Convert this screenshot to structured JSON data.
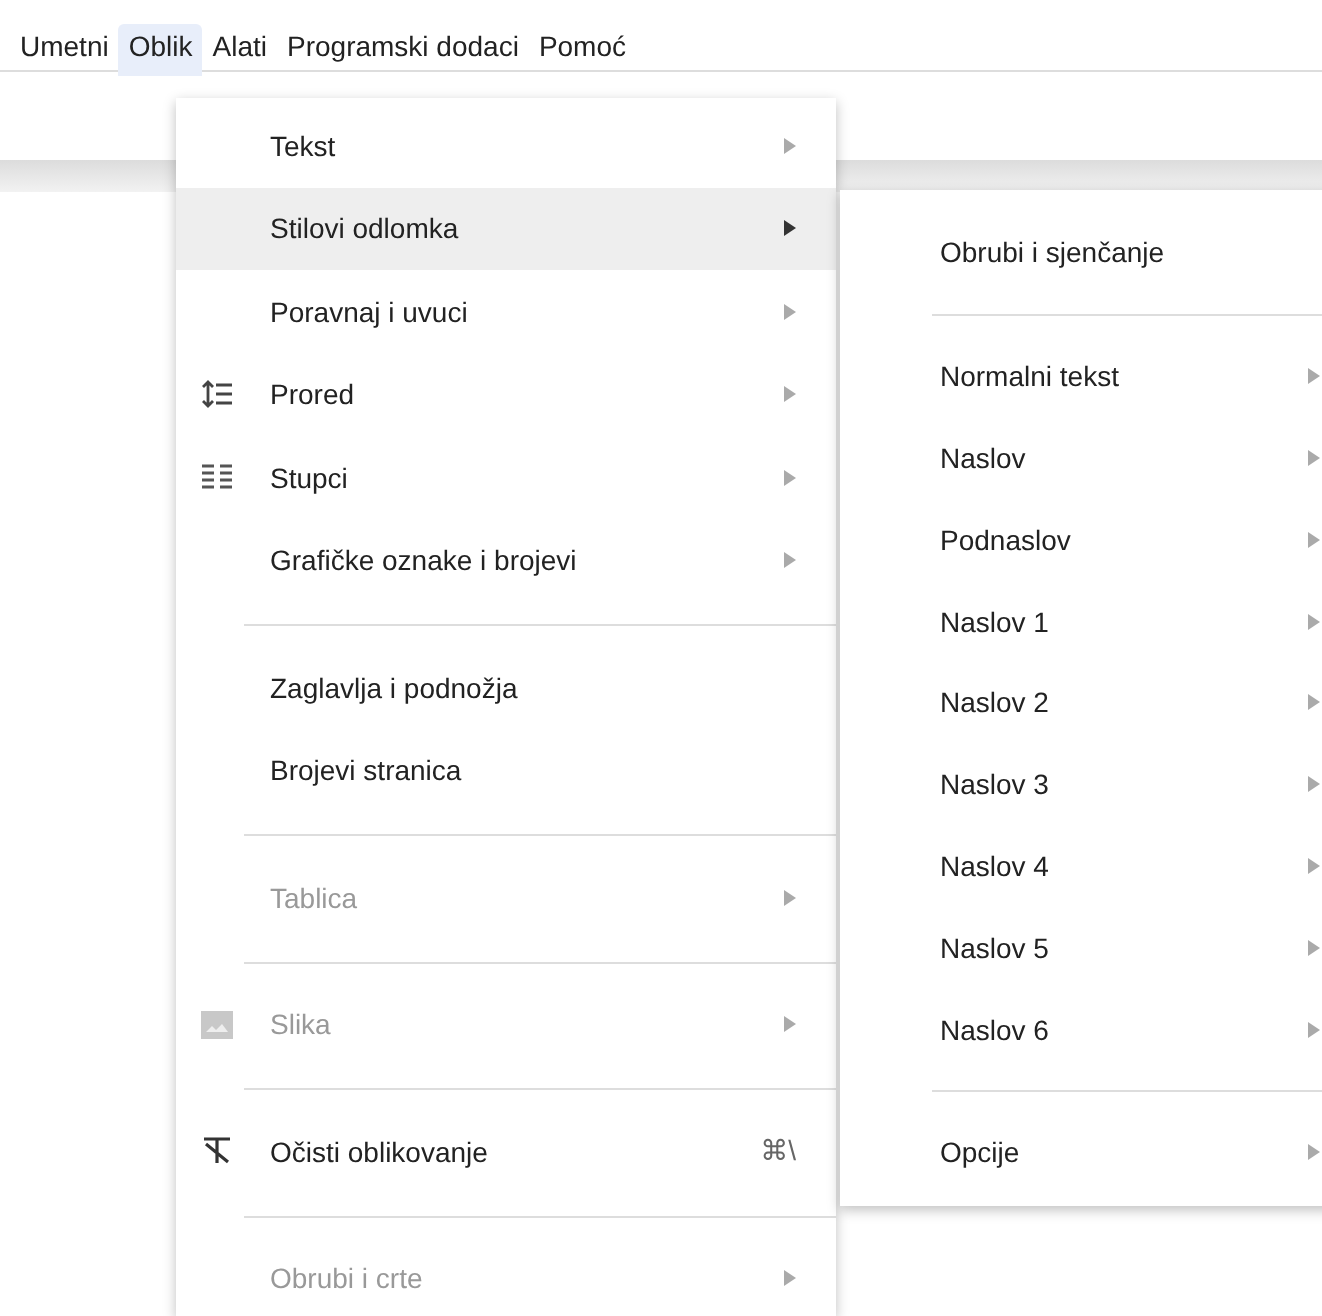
{
  "menubar": [
    {
      "label": "Umetni",
      "selected": false
    },
    {
      "label": "Oblik",
      "selected": true
    },
    {
      "label": "Alati",
      "selected": false
    },
    {
      "label": "Programski dodaci",
      "selected": false
    },
    {
      "label": "Pomoć",
      "selected": false
    }
  ],
  "menu": [
    {
      "kind": "item",
      "label": "Tekst",
      "submenu": true,
      "disabled": false,
      "selected": false
    },
    {
      "kind": "item",
      "label": "Stilovi odlomka",
      "submenu": true,
      "disabled": false,
      "selected": true
    },
    {
      "kind": "item",
      "label": "Poravnaj i uvuci",
      "submenu": true,
      "disabled": false,
      "selected": false
    },
    {
      "kind": "item",
      "label": "Prored",
      "submenu": true,
      "disabled": false,
      "selected": false
    },
    {
      "kind": "item",
      "label": "Stupci",
      "submenu": true,
      "disabled": false,
      "selected": false
    },
    {
      "kind": "item",
      "label": "Grafičke oznake i brojevi",
      "submenu": true,
      "disabled": false,
      "selected": false
    },
    {
      "kind": "separator"
    },
    {
      "kind": "item",
      "label": "Zaglavlja i podnožja",
      "submenu": false,
      "disabled": false,
      "selected": false
    },
    {
      "kind": "item",
      "label": "Brojevi stranica",
      "submenu": false,
      "disabled": false,
      "selected": false
    },
    {
      "kind": "separator"
    },
    {
      "kind": "item",
      "label": "Tablica",
      "submenu": true,
      "disabled": true,
      "selected": false
    },
    {
      "kind": "separator"
    },
    {
      "kind": "item",
      "label": "Slika",
      "submenu": true,
      "disabled": true,
      "selected": false
    },
    {
      "kind": "separator"
    },
    {
      "kind": "item",
      "label": "Očisti oblikovanje",
      "shortcut": "⌘\\",
      "submenu": false,
      "disabled": false,
      "selected": false
    },
    {
      "kind": "separator"
    },
    {
      "kind": "item",
      "label": "Obrubi i crte",
      "submenu": true,
      "disabled": true,
      "selected": false
    }
  ],
  "submenu": [
    {
      "kind": "item",
      "label": "Obrubi i sjenčanje",
      "submenu": false,
      "disabled": false,
      "selected": false
    },
    {
      "kind": "separator"
    },
    {
      "kind": "item",
      "label": "Normalni tekst",
      "submenu": true,
      "disabled": false,
      "selected": false
    },
    {
      "kind": "item",
      "label": "Naslov",
      "submenu": true,
      "disabled": false,
      "selected": false
    },
    {
      "kind": "item",
      "label": "Podnaslov",
      "submenu": true,
      "disabled": false,
      "selected": false
    },
    {
      "kind": "item",
      "label": "Naslov 1",
      "submenu": true,
      "disabled": false,
      "selected": false
    },
    {
      "kind": "item",
      "label": "Naslov 2",
      "submenu": true,
      "disabled": false,
      "selected": false
    },
    {
      "kind": "item",
      "label": "Naslov 3",
      "submenu": true,
      "disabled": false,
      "selected": false
    },
    {
      "kind": "item",
      "label": "Naslov 4",
      "submenu": true,
      "disabled": false,
      "selected": false
    },
    {
      "kind": "item",
      "label": "Naslov 5",
      "submenu": true,
      "disabled": false,
      "selected": false
    },
    {
      "kind": "item",
      "label": "Naslov 6",
      "submenu": true,
      "disabled": false,
      "selected": false
    },
    {
      "kind": "separator"
    },
    {
      "kind": "item",
      "label": "Opcije",
      "submenu": true,
      "disabled": false,
      "selected": false
    }
  ]
}
